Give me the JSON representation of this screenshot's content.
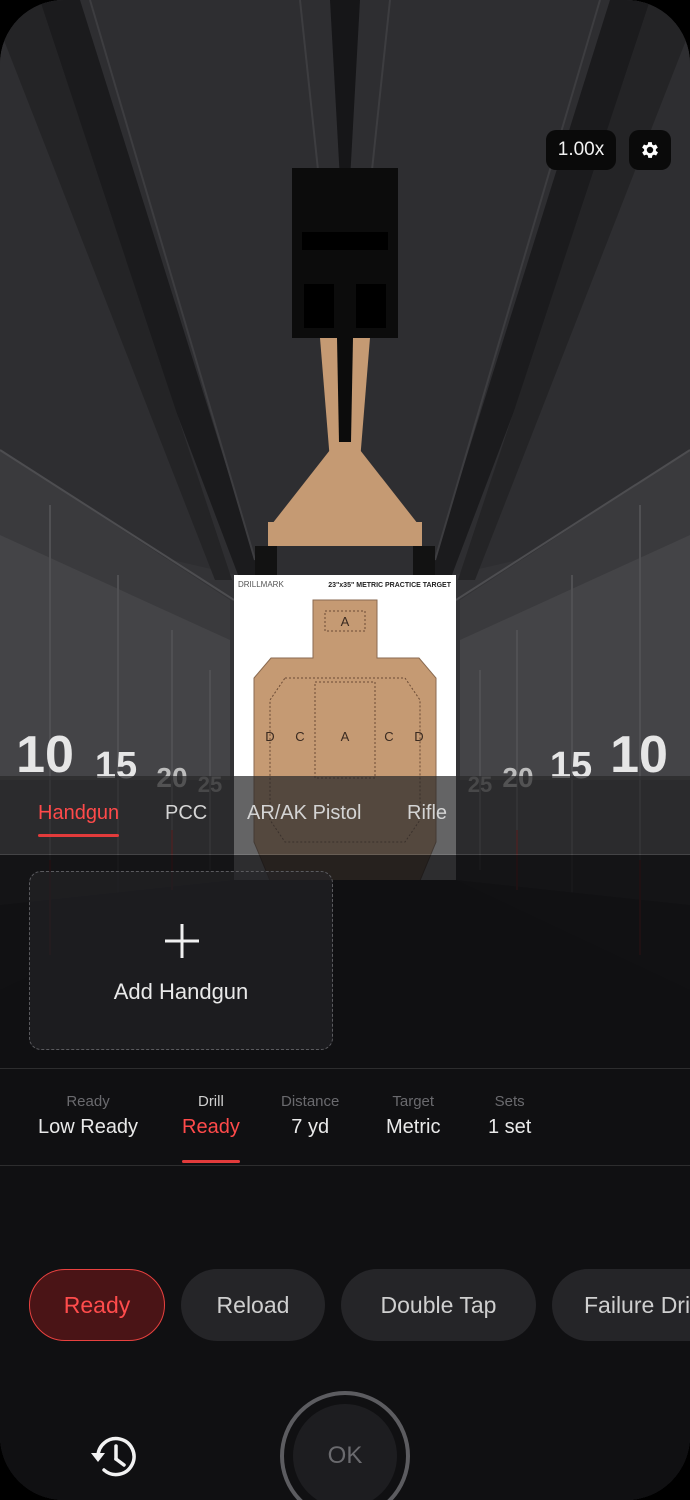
{
  "zoom": "1.00x",
  "target_sheet": {
    "brand": "DRILLMARK",
    "title": "23\"x35\" METRIC PRACTICE TARGET",
    "zones": [
      "A",
      "D",
      "C",
      "A",
      "C",
      "D"
    ]
  },
  "distance_markers": {
    "left": [
      "10",
      "15",
      "20",
      "25"
    ],
    "right": [
      "25",
      "20",
      "15",
      "10"
    ]
  },
  "categories": [
    {
      "label": "Handgun",
      "active": true
    },
    {
      "label": "PCC",
      "active": false
    },
    {
      "label": "AR/AK Pistol",
      "active": false
    },
    {
      "label": "Rifle",
      "active": false
    }
  ],
  "add_card": {
    "label": "Add Handgun",
    "icon": "plus-icon"
  },
  "settings": [
    {
      "label": "Ready",
      "value": "Low Ready",
      "active": false
    },
    {
      "label": "Drill",
      "value": "Ready",
      "active": true
    },
    {
      "label": "Distance",
      "value": "7 yd",
      "active": false
    },
    {
      "label": "Target",
      "value": "Metric",
      "active": false
    },
    {
      "label": "Sets",
      "value": "1 set",
      "active": false
    }
  ],
  "drills": [
    {
      "label": "Ready",
      "active": true
    },
    {
      "label": "Reload",
      "active": false
    },
    {
      "label": "Double Tap",
      "active": false
    },
    {
      "label": "Failure Drill",
      "active": false
    }
  ],
  "ok_button": "OK",
  "icons": {
    "settings": "gear-icon",
    "history": "history-icon"
  },
  "colors": {
    "accent": "#e8413f",
    "target_tan": "#c59a73"
  }
}
